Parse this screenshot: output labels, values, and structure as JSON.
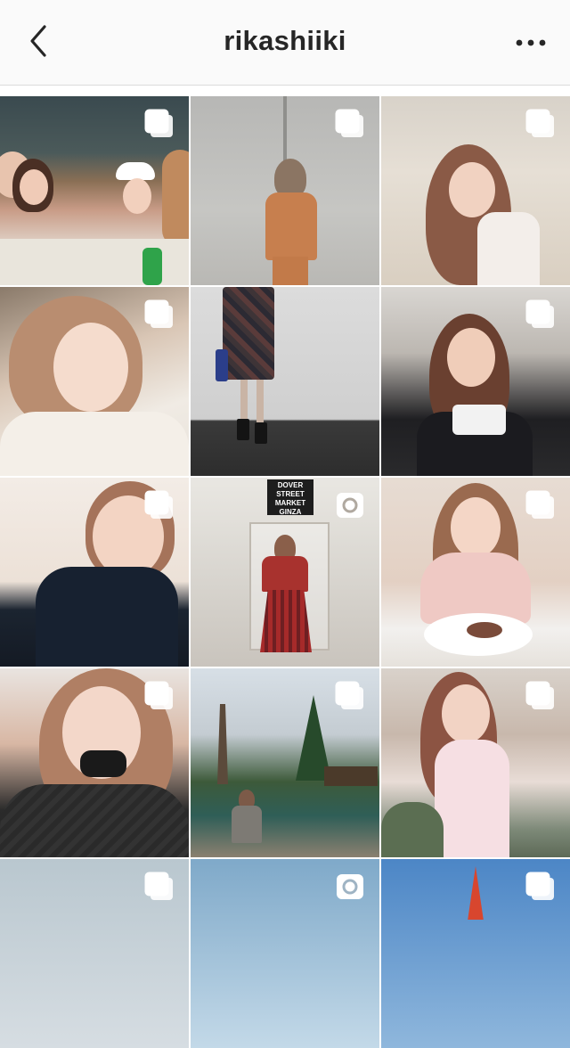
{
  "header": {
    "username": "rikashiiki",
    "back_icon": "chevron-left-icon",
    "more_icon": "more-horizontal-icon"
  },
  "posts": [
    {
      "icon": "carousel-icon"
    },
    {
      "icon": "carousel-icon"
    },
    {
      "icon": "carousel-icon"
    },
    {
      "icon": "carousel-icon"
    },
    {
      "icon": "none"
    },
    {
      "icon": "carousel-icon"
    },
    {
      "icon": "carousel-icon"
    },
    {
      "icon": "igtv-icon"
    },
    {
      "icon": "carousel-icon"
    },
    {
      "icon": "carousel-icon"
    },
    {
      "icon": "carousel-icon"
    },
    {
      "icon": "carousel-icon"
    },
    {
      "icon": "carousel-icon"
    },
    {
      "icon": "igtv-icon"
    },
    {
      "icon": "carousel-icon"
    }
  ],
  "signage": {
    "line1": "DOVER",
    "line2": "STREET",
    "line3": "MARKET",
    "line4": "GINZA"
  },
  "colors": {
    "header_bg": "#fafafa",
    "divider": "#dbdbdb",
    "text": "#262626"
  }
}
